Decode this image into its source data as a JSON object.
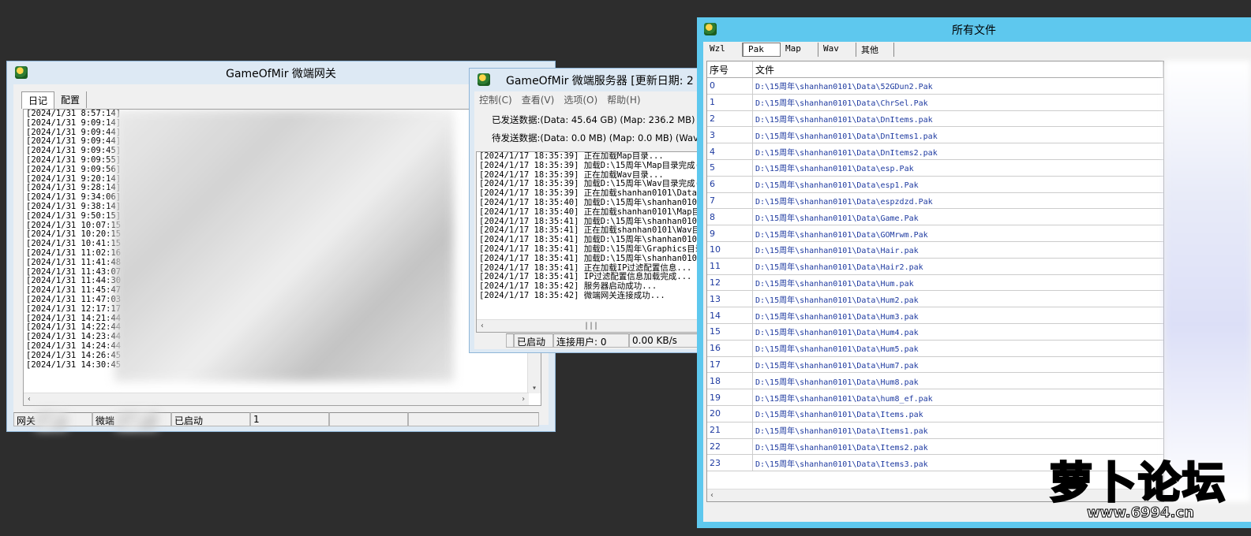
{
  "gateway": {
    "title": "GameOfMir 微端网关",
    "tabs": [
      "日记",
      "配置"
    ],
    "log": [
      "[2024/1/31 8:57:14]",
      "[2024/1/31 9:09:14]",
      "[2024/1/31 9:09:44]",
      "[2024/1/31 9:09:44]",
      "[2024/1/31 9:09:45]",
      "[2024/1/31 9:09:55]",
      "[2024/1/31 9:09:56]",
      "[2024/1/31 9:20:14]",
      "[2024/1/31 9:28:14]",
      "[2024/1/31 9:34:06]",
      "[2024/1/31 9:38:14]",
      "[2024/1/31 9:50:15]",
      "[2024/1/31 10:07:15",
      "[2024/1/31 10:20:15",
      "[2024/1/31 10:41:15",
      "[2024/1/31 11:02:16",
      "[2024/1/31 11:41:48",
      "[2024/1/31 11:43:07",
      "[2024/1/31 11:44:30",
      "[2024/1/31 11:45:47",
      "[2024/1/31 11:47:03",
      "[2024/1/31 12:17:17",
      "[2024/1/31 14:21:44",
      "[2024/1/31 14:22:44",
      "[2024/1/31 14:23:44",
      "[2024/1/31 14:24:44",
      "[2024/1/31 14:26:45",
      "[2024/1/31 14:30:45"
    ],
    "status": [
      "网关",
      "微端",
      "已启动",
      "1",
      "",
      ""
    ]
  },
  "server": {
    "title": "GameOfMir 微端服务器 [更新日期: 2",
    "menu": [
      "控制(C)",
      "查看(V)",
      "选项(O)",
      "帮助(H)"
    ],
    "sent": "已发送数据:(Data: 45.64 GB) (Map: 236.2 MB) (",
    "pending": "待发送数据:(Data: 0.0 MB) (Map: 0.0 MB) (Wav:",
    "log": [
      "[2024/1/17 18:35:39] 正在加载Map目录...",
      "[2024/1/17 18:35:39] 加载D:\\15周年\\Map目录完成(",
      "[2024/1/17 18:35:39] 正在加载Wav目录...",
      "[2024/1/17 18:35:39] 加载D:\\15周年\\Wav目录完成(",
      "[2024/1/17 18:35:39] 正在加载shanhan0101\\Data目",
      "[2024/1/17 18:35:40] 加载D:\\15周年\\shanhan0101\\",
      "[2024/1/17 18:35:40] 正在加载shanhan0101\\Map目录",
      "[2024/1/17 18:35:41] 加载D:\\15周年\\shanhan0101\\",
      "[2024/1/17 18:35:41] 正在加载shanhan0101\\Wav目录",
      "[2024/1/17 18:35:41] 加载D:\\15周年\\shanhan0101\\",
      "[2024/1/17 18:35:41] 加载D:\\15周年\\Graphics目录",
      "[2024/1/17 18:35:41] 加载D:\\15周年\\shanhan0101\\",
      "[2024/1/17 18:35:41] 正在加载IP过滤配置信息...",
      "[2024/1/17 18:35:41] IP过滤配置信息加载完成...",
      "[2024/1/17 18:35:42] 服务器启动成功...",
      "[2024/1/17 18:35:42] 微端网关连接成功..."
    ],
    "status": [
      "",
      "已启动",
      "连接用户: 0",
      "0.00 KB/s"
    ]
  },
  "files": {
    "title": "所有文件",
    "tabs": [
      "Wzl",
      "Pak",
      "Map",
      "Wav",
      "其他"
    ],
    "active_tab": "Pak",
    "col_idx": "序号",
    "col_file": "文件",
    "rows": [
      {
        "i": "0",
        "p": "D:\\15周年\\shanhan0101\\Data\\52GDun2.Pak"
      },
      {
        "i": "1",
        "p": "D:\\15周年\\shanhan0101\\Data\\ChrSel.Pak"
      },
      {
        "i": "2",
        "p": "D:\\15周年\\shanhan0101\\Data\\DnItems.pak"
      },
      {
        "i": "3",
        "p": "D:\\15周年\\shanhan0101\\Data\\DnItems1.pak"
      },
      {
        "i": "4",
        "p": "D:\\15周年\\shanhan0101\\Data\\DnItems2.pak"
      },
      {
        "i": "5",
        "p": "D:\\15周年\\shanhan0101\\Data\\esp.Pak"
      },
      {
        "i": "6",
        "p": "D:\\15周年\\shanhan0101\\Data\\esp1.Pak"
      },
      {
        "i": "7",
        "p": "D:\\15周年\\shanhan0101\\Data\\espzdzd.Pak"
      },
      {
        "i": "8",
        "p": "D:\\15周年\\shanhan0101\\Data\\Game.Pak"
      },
      {
        "i": "9",
        "p": "D:\\15周年\\shanhan0101\\Data\\GOMrwm.Pak"
      },
      {
        "i": "10",
        "p": "D:\\15周年\\shanhan0101\\Data\\Hair.pak"
      },
      {
        "i": "11",
        "p": "D:\\15周年\\shanhan0101\\Data\\Hair2.pak"
      },
      {
        "i": "12",
        "p": "D:\\15周年\\shanhan0101\\Data\\Hum.pak"
      },
      {
        "i": "13",
        "p": "D:\\15周年\\shanhan0101\\Data\\Hum2.pak"
      },
      {
        "i": "14",
        "p": "D:\\15周年\\shanhan0101\\Data\\Hum3.pak"
      },
      {
        "i": "15",
        "p": "D:\\15周年\\shanhan0101\\Data\\Hum4.pak"
      },
      {
        "i": "16",
        "p": "D:\\15周年\\shanhan0101\\Data\\Hum5.pak"
      },
      {
        "i": "17",
        "p": "D:\\15周年\\shanhan0101\\Data\\Hum7.pak"
      },
      {
        "i": "18",
        "p": "D:\\15周年\\shanhan0101\\Data\\Hum8.pak"
      },
      {
        "i": "19",
        "p": "D:\\15周年\\shanhan0101\\Data\\hum8_ef.pak"
      },
      {
        "i": "20",
        "p": "D:\\15周年\\shanhan0101\\Data\\Items.pak"
      },
      {
        "i": "21",
        "p": "D:\\15周年\\shanhan0101\\Data\\Items1.pak"
      },
      {
        "i": "22",
        "p": "D:\\15周年\\shanhan0101\\Data\\Items2.pak"
      },
      {
        "i": "23",
        "p": "D:\\15周年\\shanhan0101\\Data\\Items3.pak"
      }
    ]
  },
  "watermark": {
    "brand": "萝卜论坛",
    "url": "www.6994.cn"
  },
  "colors": {
    "desktop": "#2d2d2d",
    "files_frame": "#5ec8ee",
    "path_text": "#1e3aa0"
  }
}
